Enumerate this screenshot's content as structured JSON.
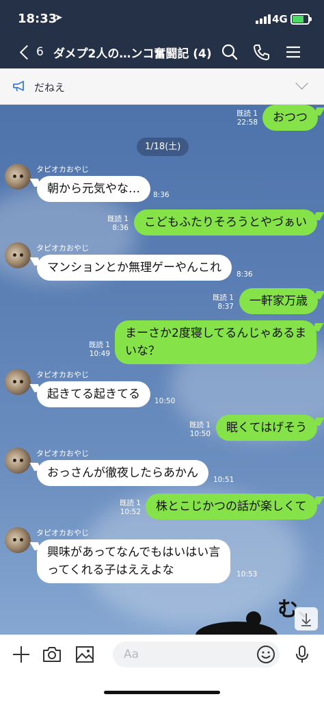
{
  "status": {
    "time": "18:33",
    "location_icon": "location-arrow-icon",
    "network": "4G",
    "battery_color": "#4cd964"
  },
  "header": {
    "back_count": "6",
    "title": "ダメプ2人の…ンコ奮闘記 (4)",
    "icons": [
      "search-icon",
      "phone-icon",
      "menu-icon"
    ],
    "background": "#253147"
  },
  "announcement": {
    "text": "だねえ",
    "icon": "megaphone-icon"
  },
  "chat": {
    "date": "1/18(土)",
    "read_label": "既読 1",
    "sender_name": "タピオカおやじ",
    "messages": [
      {
        "side": "me",
        "text": "おつつ",
        "read": "既読 1",
        "time": "22:58"
      },
      {
        "side": "them",
        "sender": "タピオカおやじ",
        "text": "朝から元気やな…",
        "time": "8:36"
      },
      {
        "side": "me",
        "text": "こどもふたりそろうとやづぁい",
        "read": "既読 1",
        "time": "8:36"
      },
      {
        "side": "them",
        "sender": "タピオカおやじ",
        "text": "マンションとか無理ゲーやんこれ",
        "time": "8:36"
      },
      {
        "side": "me",
        "text": "一軒家万歳",
        "read": "既読 1",
        "time": "8:37"
      },
      {
        "side": "me",
        "text": "まーさか2度寝してるんじゃあるまいな？",
        "line1": "まーさか2度寝してるんじゃあるま",
        "line2": "いな？",
        "read": "既読 1",
        "time": "10:49"
      },
      {
        "side": "them",
        "sender": "タピオカおやじ",
        "text": "起きてる起きてる",
        "time": "10:50"
      },
      {
        "side": "me",
        "text": "眠くてはげそう",
        "read": "既読 1",
        "time": "10:50"
      },
      {
        "side": "them",
        "sender": "タピオカおやじ",
        "text": "おっさんが徹夜したらあかん",
        "time": "10:51"
      },
      {
        "side": "me",
        "text": "株とこじかつの話が楽しくて",
        "read": "既読 1",
        "time": "10:52"
      },
      {
        "side": "them",
        "sender": "タピオカおやじ",
        "text": "興味があってなんでもはいはい言ってくれる子はええよな",
        "line1": "興味があってなんでもはいはい言",
        "line2": "ってくれる子はええよな",
        "time": "10:53"
      }
    ],
    "sticker_text": "む、",
    "colors": {
      "my_bubble": "#85e249",
      "their_bubble": "#ffffff"
    }
  },
  "input": {
    "placeholder": "Aa",
    "icons": [
      "plus-icon",
      "camera-icon",
      "image-icon",
      "emoji-icon",
      "microphone-icon"
    ]
  }
}
